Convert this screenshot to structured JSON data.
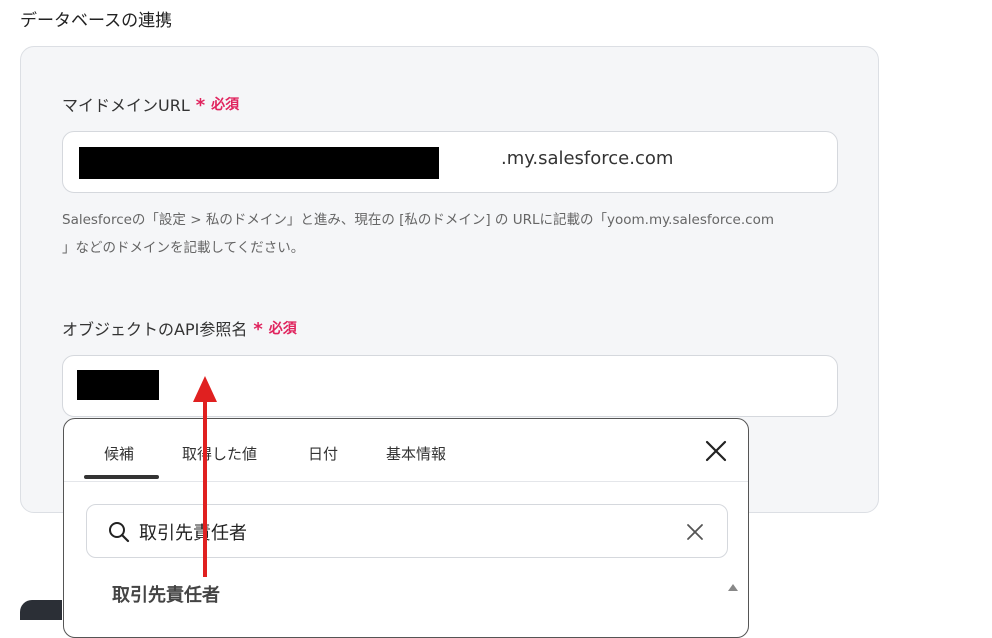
{
  "section": {
    "title": "データベースの連携"
  },
  "domain_field": {
    "label": "マイドメインURL",
    "required_star": "*",
    "required_text": "必須",
    "value_suffix": ".my.salesforce.com",
    "help_line1": "Salesforceの「設定 > 私のドメイン」と進み、現在の [私のドメイン] の URLに記載の「yoom.my.salesforce.com",
    "help_line2": "」などのドメインを記載してください。"
  },
  "object_field": {
    "label": "オブジェクトのAPI参照名",
    "required_star": "*",
    "required_text": "必須"
  },
  "dropdown": {
    "tabs": [
      "候補",
      "取得した値",
      "日付",
      "基本情報"
    ],
    "active_tab": "候補",
    "search_value": "取引先責任者",
    "results": [
      "取引先責任者"
    ]
  },
  "colors": {
    "required": "#e0245e",
    "arrow": "#e02020"
  }
}
